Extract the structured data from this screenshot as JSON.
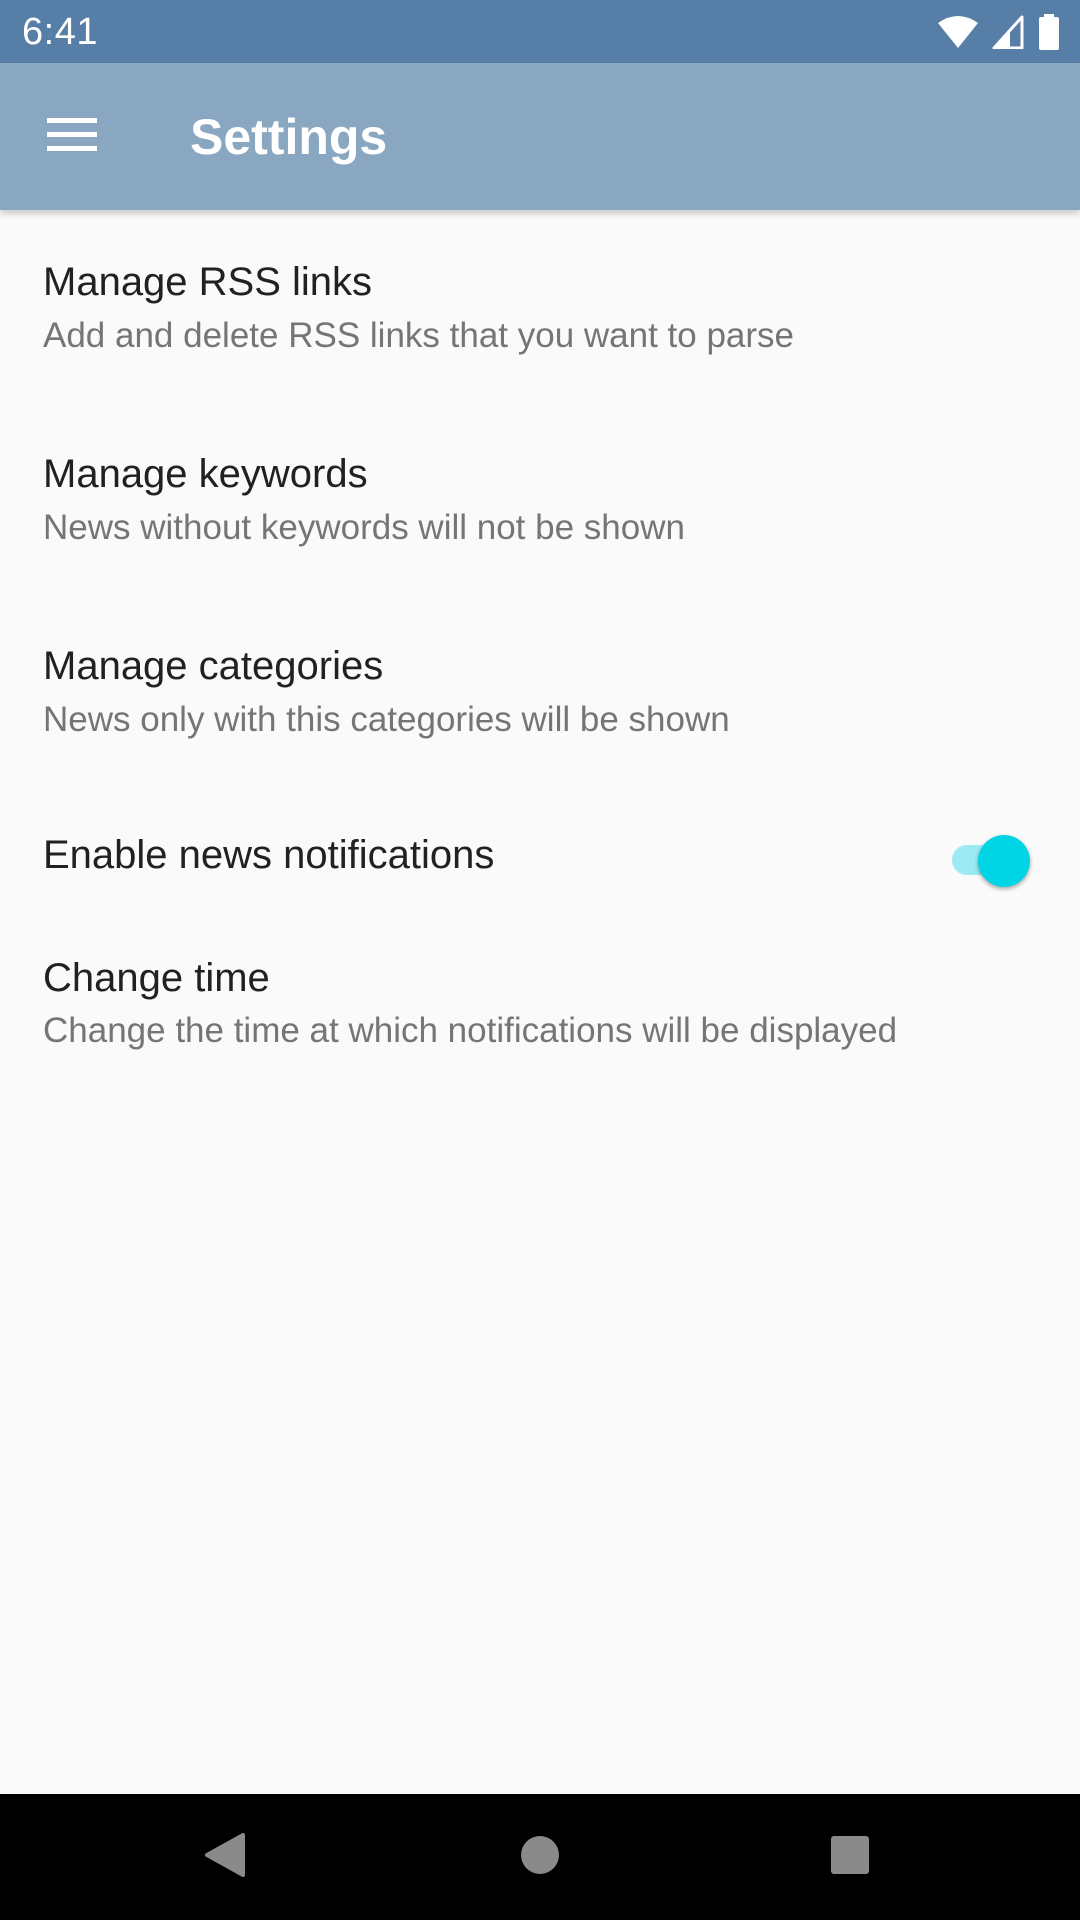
{
  "status_bar": {
    "time": "6:41",
    "icons": [
      "wifi-icon",
      "cell-signal-icon",
      "battery-icon"
    ]
  },
  "app_bar": {
    "menu_icon": "hamburger-menu-icon",
    "title": "Settings"
  },
  "settings": {
    "items": [
      {
        "title": "Manage RSS links",
        "summary": "Add and delete RSS links that you want to parse"
      },
      {
        "title": "Manage keywords",
        "summary": "News without keywords will not be shown"
      },
      {
        "title": "Manage categories",
        "summary": "News only with this categories will be shown"
      },
      {
        "title": "Enable news notifications",
        "toggle_on": true
      },
      {
        "title": "Change time",
        "summary": "Change the time at which notifications will be displayed"
      }
    ]
  },
  "nav_bar": {
    "buttons": [
      "back-icon",
      "home-icon",
      "recents-icon"
    ]
  },
  "colors": {
    "status_bar": "#577ea6",
    "app_bar": "#8aa7c1",
    "background": "#fafafa",
    "accent": "#00d5e6",
    "accent_track": "#9ceaf3",
    "title_text": "#212121",
    "summary_text": "#757575"
  }
}
